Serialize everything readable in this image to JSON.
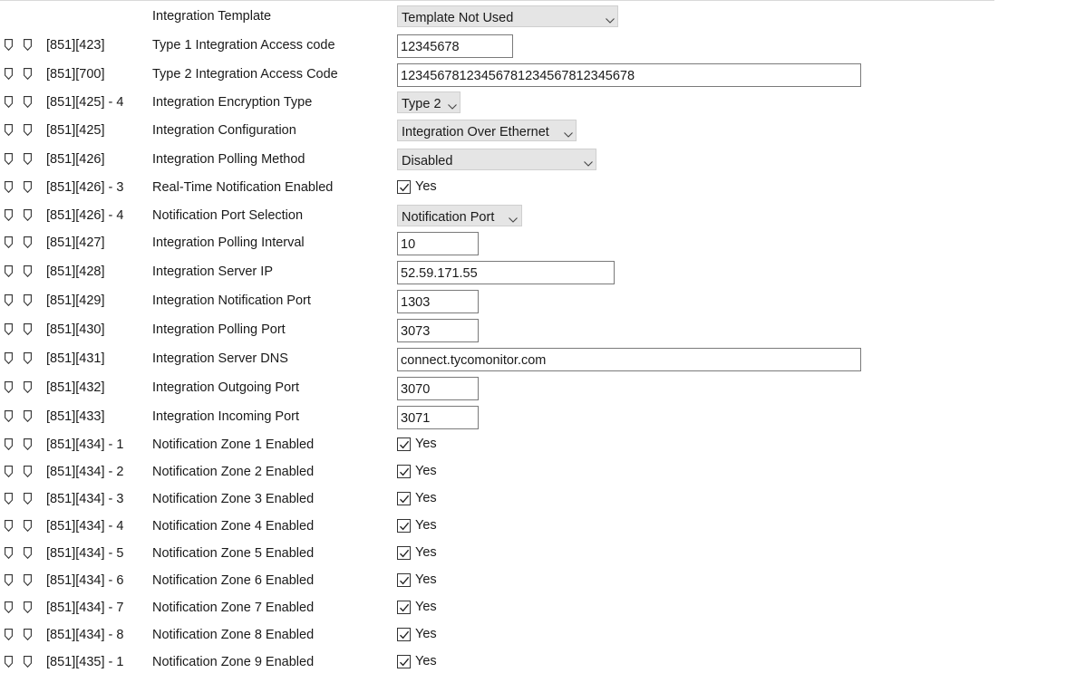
{
  "template_row": {
    "label": "Integration Template",
    "select_value": "Template Not Used"
  },
  "rows": [
    {
      "code": "[851][423]",
      "label": "Type 1 Integration Access code",
      "value": "12345678"
    },
    {
      "code": "[851][700]",
      "label": "Type 2 Integration Access Code",
      "value": "12345678123456781234567812345678"
    },
    {
      "code": "[851][425] - 4",
      "label": "Integration Encryption Type",
      "value": "Type 2"
    },
    {
      "code": "[851][425]",
      "label": "Integration Configuration",
      "value": "Integration Over Ethernet"
    },
    {
      "code": "[851][426]",
      "label": "Integration Polling Method",
      "value": "Disabled"
    },
    {
      "code": "[851][426] - 3",
      "label": "Real-Time Notification Enabled",
      "value": "Yes"
    },
    {
      "code": "[851][426] - 4",
      "label": "Notification Port Selection",
      "value": "Notification Port"
    },
    {
      "code": "[851][427]",
      "label": "Integration Polling Interval",
      "value": "10"
    },
    {
      "code": "[851][428]",
      "label": "Integration Server IP",
      "value": "52.59.171.55"
    },
    {
      "code": "[851][429]",
      "label": "Integration Notification Port",
      "value": "1303"
    },
    {
      "code": "[851][430]",
      "label": "Integration Polling Port",
      "value": "3073"
    },
    {
      "code": "[851][431]",
      "label": "Integration Server DNS",
      "value": "connect.tycomonitor.com"
    },
    {
      "code": "[851][432]",
      "label": "Integration Outgoing Port",
      "value": "3070"
    },
    {
      "code": "[851][433]",
      "label": "Integration Incoming Port",
      "value": "3071"
    },
    {
      "code": "[851][434] - 1",
      "label": "Notification Zone 1 Enabled",
      "value": "Yes"
    },
    {
      "code": "[851][434] - 2",
      "label": "Notification Zone 2 Enabled",
      "value": "Yes"
    },
    {
      "code": "[851][434] - 3",
      "label": "Notification Zone 3 Enabled",
      "value": "Yes"
    },
    {
      "code": "[851][434] - 4",
      "label": "Notification Zone 4 Enabled",
      "value": "Yes"
    },
    {
      "code": "[851][434] - 5",
      "label": "Notification Zone 5 Enabled",
      "value": "Yes"
    },
    {
      "code": "[851][434] - 6",
      "label": "Notification Zone 6 Enabled",
      "value": "Yes"
    },
    {
      "code": "[851][434] - 7",
      "label": "Notification Zone 7 Enabled",
      "value": "Yes"
    },
    {
      "code": "[851][434] - 8",
      "label": "Notification Zone 8 Enabled",
      "value": "Yes"
    },
    {
      "code": "[851][435] - 1",
      "label": "Notification Zone 9 Enabled",
      "value": "Yes"
    }
  ],
  "icons": {
    "row_markers": [
      "flag-icon",
      "flag-icon"
    ],
    "select_arrow": "chevron-down-icon",
    "check_mark": "checkmark-icon"
  }
}
